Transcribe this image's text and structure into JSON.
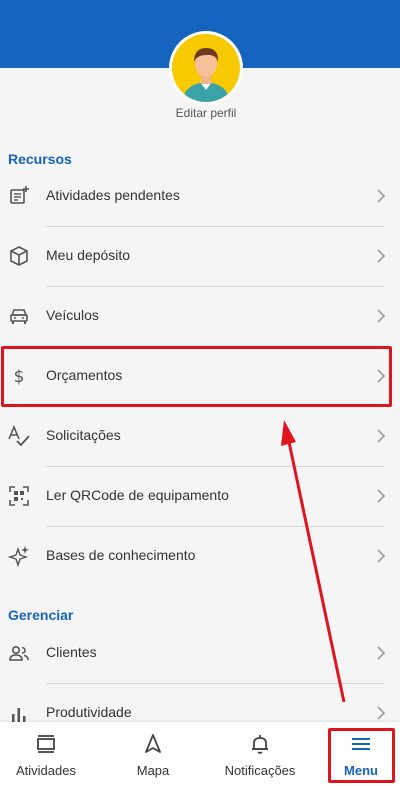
{
  "profile": {
    "edit_label": "Editar perfil"
  },
  "sections": [
    {
      "title": "Recursos",
      "items": [
        {
          "icon": "pending-list-icon",
          "label": "Atividades pendentes"
        },
        {
          "icon": "package-icon",
          "label": "Meu depósito"
        },
        {
          "icon": "car-icon",
          "label": "Veículos"
        },
        {
          "icon": "dollar-icon",
          "label": "Orçamentos"
        },
        {
          "icon": "spellcheck-icon",
          "label": "Solicitações"
        },
        {
          "icon": "qrcode-icon",
          "label": "Ler QRCode de equipamento"
        },
        {
          "icon": "sparkles-icon",
          "label": "Bases de conhecimento"
        }
      ]
    },
    {
      "title": "Gerenciar",
      "items": [
        {
          "icon": "people-icon",
          "label": "Clientes"
        },
        {
          "icon": "bar-chart-icon",
          "label": "Produtividade"
        }
      ]
    }
  ],
  "bottom_nav": [
    {
      "icon": "activities-icon",
      "label": "Atividades"
    },
    {
      "icon": "navigation-icon",
      "label": "Mapa"
    },
    {
      "icon": "bell-icon",
      "label": "Notificações"
    },
    {
      "icon": "menu-icon",
      "label": "Menu",
      "active": true
    }
  ],
  "colors": {
    "primary": "#1565c0",
    "highlight": "#e0141e",
    "avatar_bg": "#f7c900"
  }
}
